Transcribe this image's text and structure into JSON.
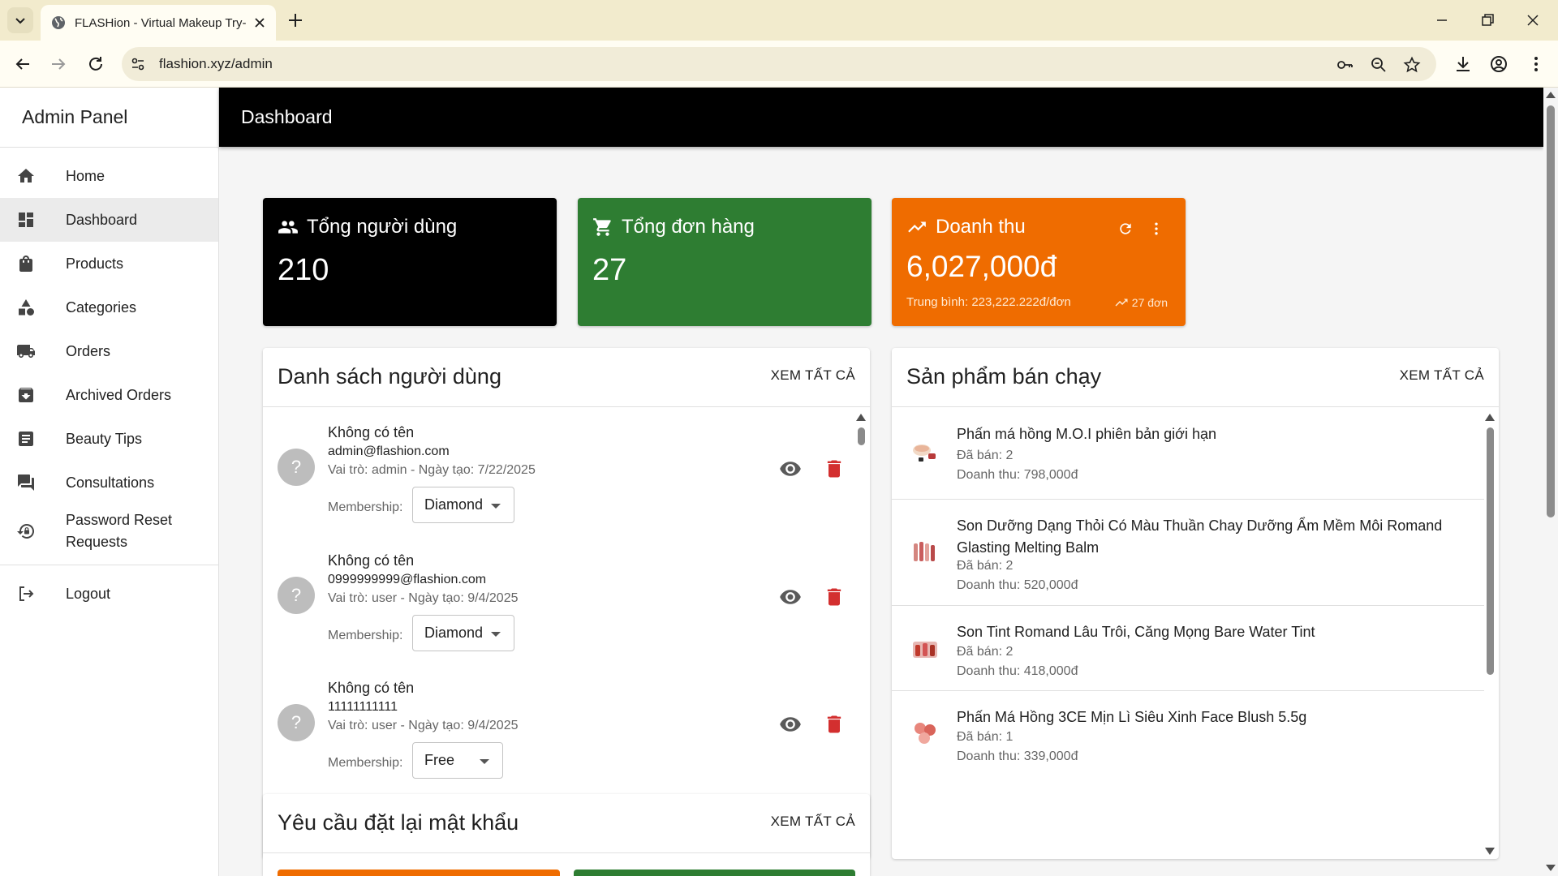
{
  "browser": {
    "tab_title": "FLASHion - Virtual Makeup Try-",
    "url": "flashion.xyz/admin"
  },
  "sidebar": {
    "brand": "Admin Panel",
    "items": [
      {
        "label": "Home",
        "icon": "home-icon"
      },
      {
        "label": "Dashboard",
        "icon": "dashboard-icon"
      },
      {
        "label": "Products",
        "icon": "shopping-bag-icon"
      },
      {
        "label": "Categories",
        "icon": "category-icon"
      },
      {
        "label": "Orders",
        "icon": "truck-icon"
      },
      {
        "label": "Archived Orders",
        "icon": "archive-icon"
      },
      {
        "label": "Beauty Tips",
        "icon": "article-icon"
      },
      {
        "label": "Consultations",
        "icon": "forum-icon"
      },
      {
        "label": "Password Reset Requests",
        "icon": "lock-reset-icon"
      }
    ],
    "logout": "Logout"
  },
  "topbar": {
    "title": "Dashboard"
  },
  "stats": {
    "users": {
      "label": "Tổng người dùng",
      "value": "210",
      "color": "#000000"
    },
    "orders": {
      "label": "Tổng đơn hàng",
      "value": "27",
      "color": "#2e7d32"
    },
    "revenue": {
      "label": "Doanh thu",
      "value": "6,027,000đ",
      "average": "Trung bình: 223,222.222đ/đơn",
      "orders_badge": "27 đơn",
      "color": "#ef6c00"
    }
  },
  "users_panel": {
    "title": "Danh sách người dùng",
    "view_all": "XEM TẤT CẢ",
    "membership_label": "Membership:",
    "users": [
      {
        "name": "Không có tên",
        "email": "admin@flashion.com",
        "meta": "Vai trò: admin - Ngày tạo: 7/22/2025",
        "membership": "Diamond",
        "avatar": "?"
      },
      {
        "name": "Không có tên",
        "email": "0999999999@flashion.com",
        "meta": "Vai trò: user - Ngày tạo: 9/4/2025",
        "membership": "Diamond",
        "avatar": "?"
      },
      {
        "name": "Không có tên",
        "email": "11111111111",
        "meta": "Vai trò: user - Ngày tạo: 9/4/2025",
        "membership": "Free",
        "avatar": "?"
      }
    ]
  },
  "products_panel": {
    "title": "Sản phẩm bán chạy",
    "view_all": "XEM TẤT CẢ",
    "products": [
      {
        "name": "Phấn má hồng M.O.I phiên bản giới hạn",
        "sold": "Đã bán: 2",
        "revenue": "Doanh thu: 798,000đ"
      },
      {
        "name": "Son Dưỡng Dạng Thỏi Có Màu Thuần Chay Dưỡng Ẩm Mềm Môi Romand Glasting Melting Balm",
        "sold": "Đã bán: 2",
        "revenue": "Doanh thu: 520,000đ"
      },
      {
        "name": "Son Tint Romand Lâu Trôi, Căng Mọng Bare Water Tint",
        "sold": "Đã bán: 2",
        "revenue": "Doanh thu: 418,000đ"
      },
      {
        "name": "Phấn Má Hồng 3CE Mịn Lì Siêu Xinh Face Blush 5.5g",
        "sold": "Đã bán: 1",
        "revenue": "Doanh thu: 339,000đ"
      }
    ]
  },
  "reset_panel": {
    "title": "Yêu cầu đặt lại mật khẩu",
    "view_all": "XEM TẤT CẢ"
  }
}
